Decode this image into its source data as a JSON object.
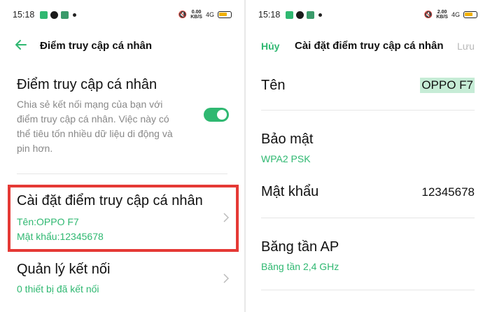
{
  "left": {
    "status": {
      "time": "15:18",
      "speed_top": "0.00",
      "speed_bottom": "KB/S",
      "signal": "4G"
    },
    "header": {
      "title": "Điểm truy cập cá nhân"
    },
    "hotspot": {
      "title": "Điểm truy cập cá nhân",
      "desc_lines": [
        "Chia sẻ kết nối mạng của bạn với",
        "điểm truy cập cá nhân. Việc này có",
        "thể tiêu tốn nhiều dữ liệu di động và",
        "pin hơn."
      ],
      "enabled": true
    },
    "settings": {
      "title": "Cài đặt điểm truy cập cá nhân",
      "name_line": "Tên:OPPO F7",
      "password_line": "Mật khẩu:12345678"
    },
    "connections": {
      "title": "Quản lý kết nối",
      "count_line": "0 thiết bị đã kết nối"
    },
    "colors": {
      "accent": "#2fb871",
      "highlight": "#e53935"
    }
  },
  "right": {
    "status": {
      "time": "15:18",
      "speed_top": "2.00",
      "speed_bottom": "KB/S",
      "signal": "4G"
    },
    "header": {
      "cancel": "Hủy",
      "title": "Cài đặt điểm truy cập cá nhân",
      "save": "Lưu"
    },
    "name": {
      "label": "Tên",
      "value": "OPPO F7"
    },
    "security": {
      "label": "Bảo mật",
      "value": "WPA2 PSK"
    },
    "password": {
      "label": "Mật khẩu",
      "value": "12345678"
    },
    "band": {
      "label": "Băng tần AP",
      "value": "Băng tần 2,4 GHz"
    }
  }
}
